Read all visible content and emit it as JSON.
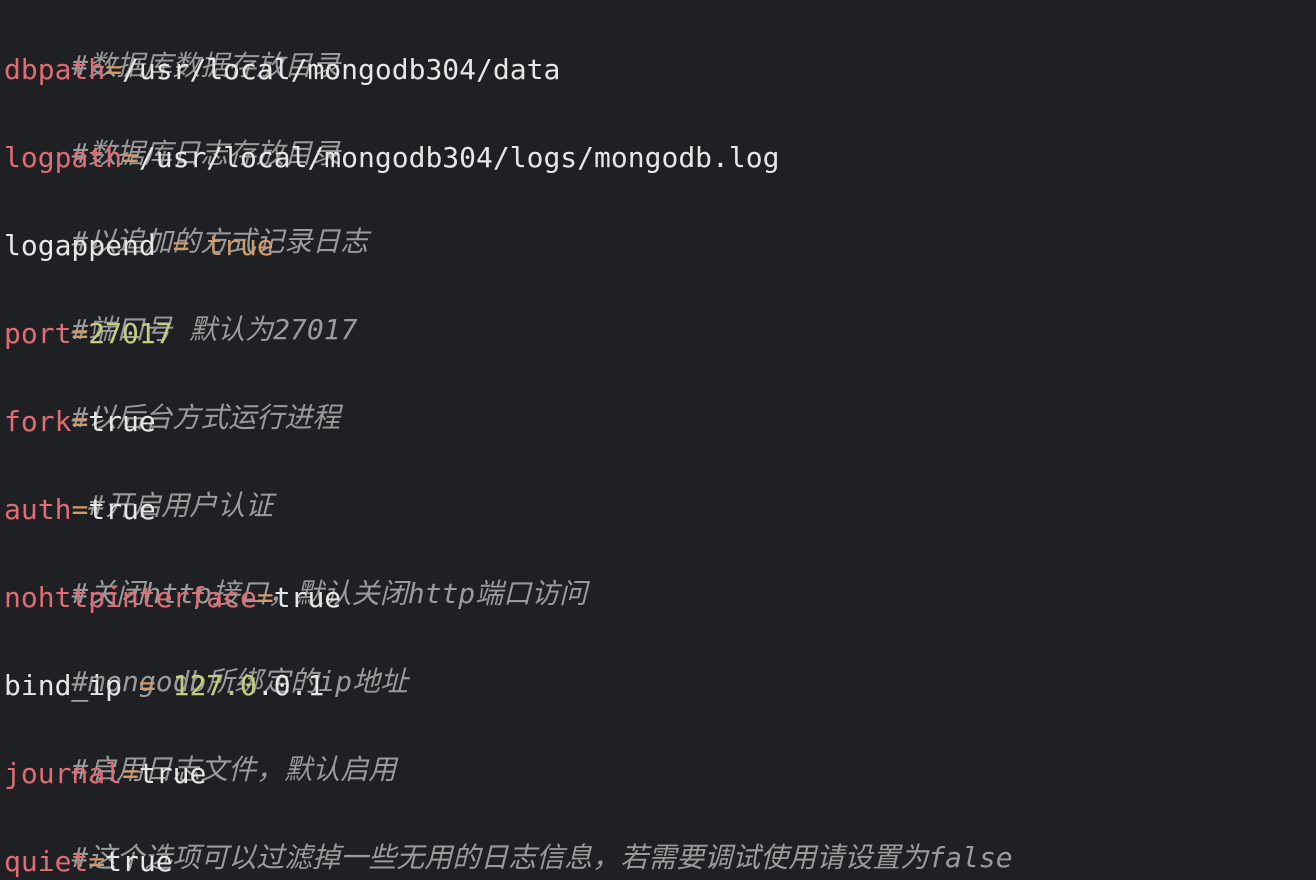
{
  "editor": {
    "theme": {
      "background": "#1f2023",
      "comment": "#9a9a9a",
      "key": "#e06c75",
      "operator": "#d19a66",
      "number": "#c3cf7a",
      "text": "#e6e6e6"
    },
    "lines": {
      "l1": {
        "comment": "#数据库数据存放目录"
      },
      "l2": {
        "key": "dbpath",
        "eq": "=",
        "value": "/usr/local/mongodb304/data"
      },
      "l3": {
        "comment": "#数据库日志存放目录"
      },
      "l4": {
        "key": "logpath",
        "eq": "=",
        "value": "/usr/local/mongodb304/logs/mongodb.log"
      },
      "l5": {
        "comment": "#以追加的方式记录日志"
      },
      "l6": {
        "key": "logappend",
        "eq": " = ",
        "value": "true"
      },
      "l7": {
        "comment": "#端口号 默认为27017"
      },
      "l8": {
        "key": "port",
        "eq": "=",
        "value": "27017"
      },
      "l9": {
        "comment": "#以后台方式运行进程"
      },
      "l10": {
        "key": "fork",
        "eq": "=",
        "value": "true"
      },
      "l11": {
        "comment": " #开启用户认证"
      },
      "l12": {
        "key": "auth",
        "eq": "=",
        "value": "true"
      },
      "l13": {
        "comment": "#关闭http接口，默认关闭http端口访问"
      },
      "l14": {
        "key": "nohttpinterface",
        "eq": "=",
        "value": "true"
      },
      "l15": {
        "comment": "#mongodb所绑定的ip地址"
      },
      "l16": {
        "key": "bind_ip",
        "eq": " = ",
        "value_a": "127.0",
        "value_b": ".0.1"
      },
      "l17": {
        "comment": "#启用日志文件，默认启用"
      },
      "l18": {
        "key": "journal",
        "eq": "=",
        "value": "true"
      },
      "l19": {
        "comment": "#这个选项可以过滤掉一些无用的日志信息，若需要调试使用请设置为false"
      },
      "l20": {
        "key": "quiet",
        "eq": "=",
        "value": "true"
      }
    }
  }
}
